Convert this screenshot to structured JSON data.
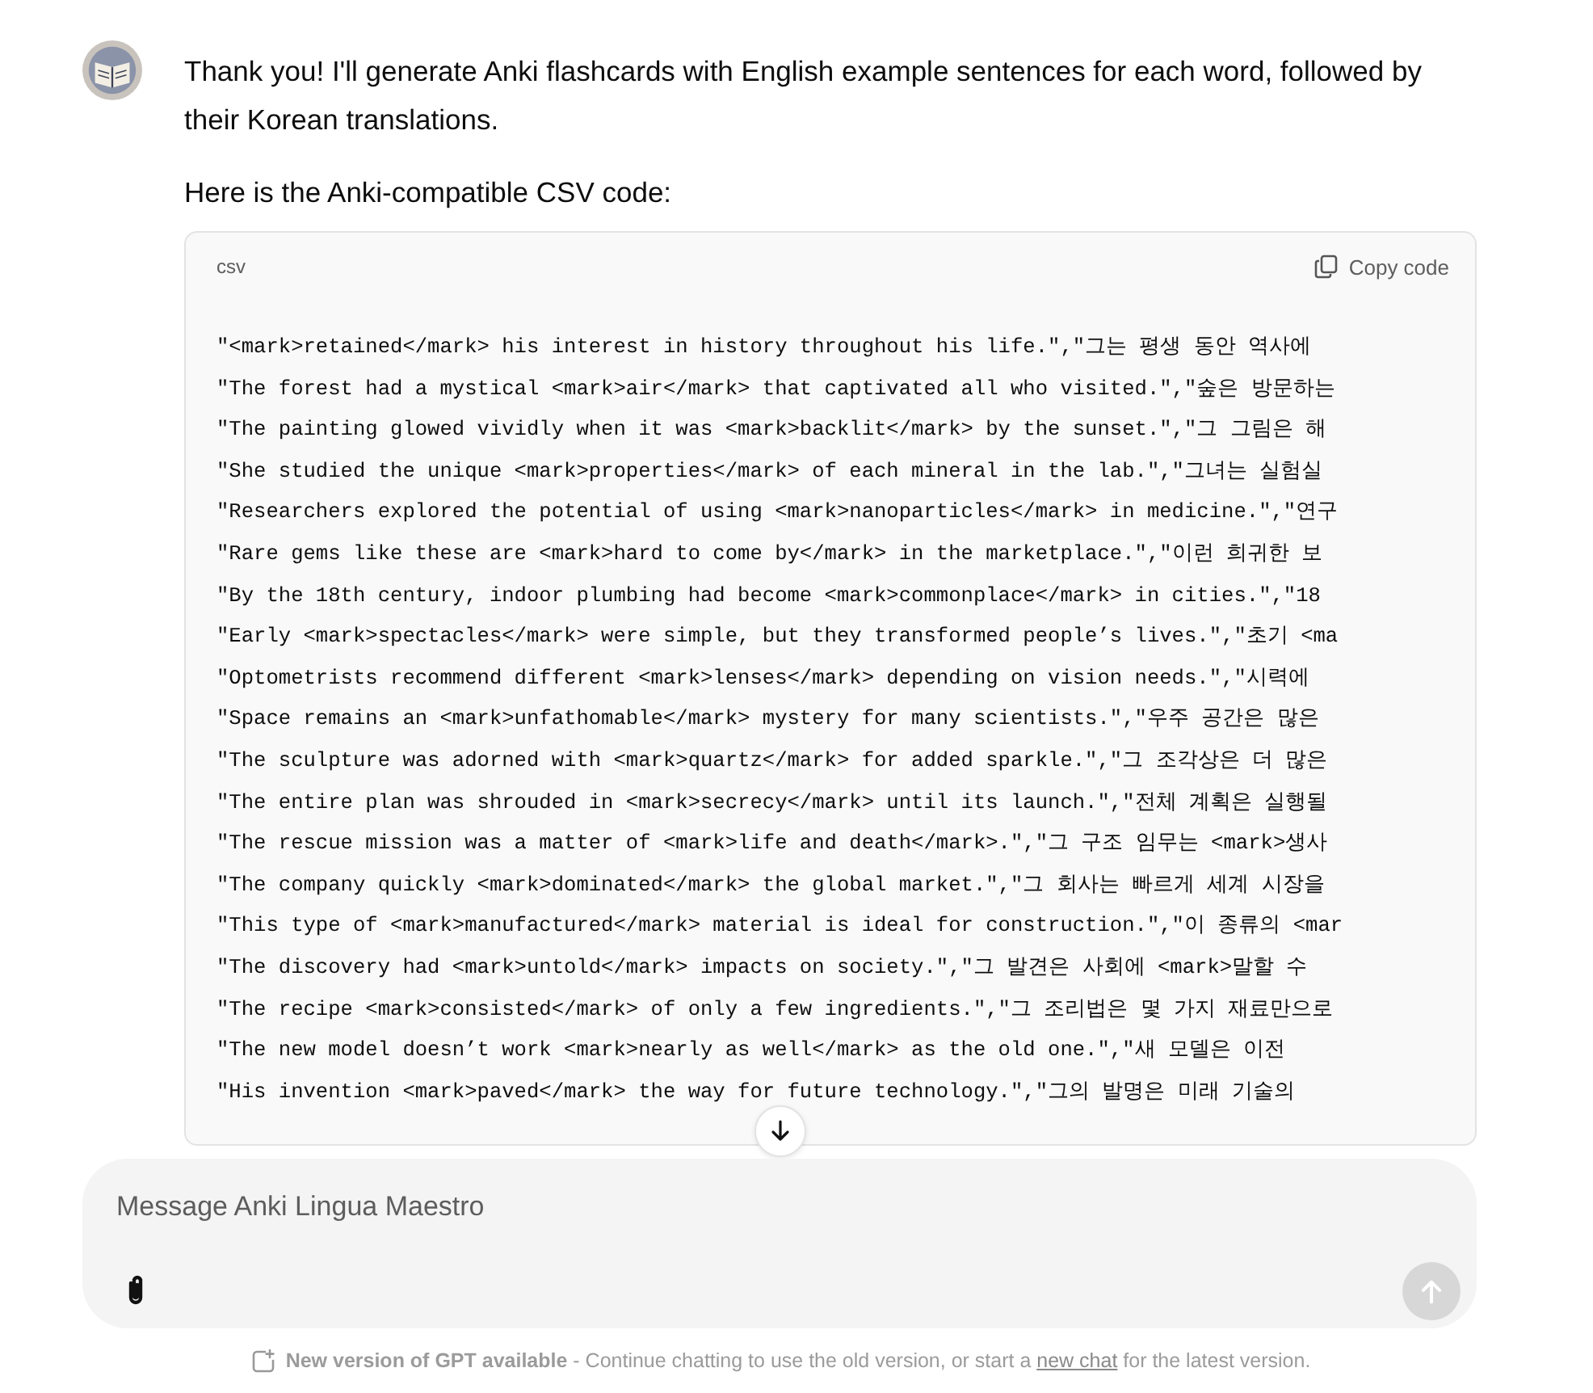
{
  "message": {
    "paragraphs": [
      "Thank you! I'll generate Anki flashcards with English example sentences for each word, followed by their Korean translations.",
      "Here is the Anki-compatible CSV code:"
    ],
    "code": {
      "language": "csv",
      "copy_label": "Copy code",
      "lines": [
        "\"<mark>retained</mark> his interest in history throughout his life.\",\"그는 평생 동안 역사에",
        "\"The forest had a mystical <mark>air</mark> that captivated all who visited.\",\"숲은 방문하는",
        "\"The painting glowed vividly when it was <mark>backlit</mark> by the sunset.\",\"그 그림은 해",
        "\"She studied the unique <mark>properties</mark> of each mineral in the lab.\",\"그녀는 실험실",
        "\"Researchers explored the potential of using <mark>nanoparticles</mark> in medicine.\",\"연구",
        "\"Rare gems like these are <mark>hard to come by</mark> in the marketplace.\",\"이런 희귀한 보",
        "\"By the 18th century, indoor plumbing had become <mark>commonplace</mark> in cities.\",\"18",
        "\"Early <mark>spectacles</mark> were simple, but they transformed people’s lives.\",\"초기 <ma",
        "\"Optometrists recommend different <mark>lenses</mark> depending on vision needs.\",\"시력에",
        "\"Space remains an <mark>unfathomable</mark> mystery for many scientists.\",\"우주 공간은 많은",
        "\"The sculpture was adorned with <mark>quartz</mark> for added sparkle.\",\"그 조각상은 더 많은",
        "\"The entire plan was shrouded in <mark>secrecy</mark> until its launch.\",\"전체 계획은 실행될",
        "\"The rescue mission was a matter of <mark>life and death</mark>.\",\"그 구조 임무는 <mark>생사",
        "\"The company quickly <mark>dominated</mark> the global market.\",\"그 회사는 빠르게 세계 시장을",
        "\"This type of <mark>manufactured</mark> material is ideal for construction.\",\"이 종류의 <mar",
        "\"The discovery had <mark>untold</mark> impacts on society.\",\"그 발견은 사회에 <mark>말할 수",
        "\"The recipe <mark>consisted</mark> of only a few ingredients.\",\"그 조리법은 몇 가지 재료만으로",
        "\"The new model doesn’t work <mark>nearly as well</mark> as the old one.\",\"새 모델은 이전",
        "\"His invention <mark>paved</mark> the way for future technology.\",\"그의 발명은 미래 기술의"
      ]
    }
  },
  "composer": {
    "placeholder": "Message Anki Lingua Maestro",
    "send_disabled": true
  },
  "notice": {
    "text": "**New version of GPT available** - Continue chatting to use the old version, or start a",
    "link": "new chat",
    "after": "for the latest version."
  }
}
